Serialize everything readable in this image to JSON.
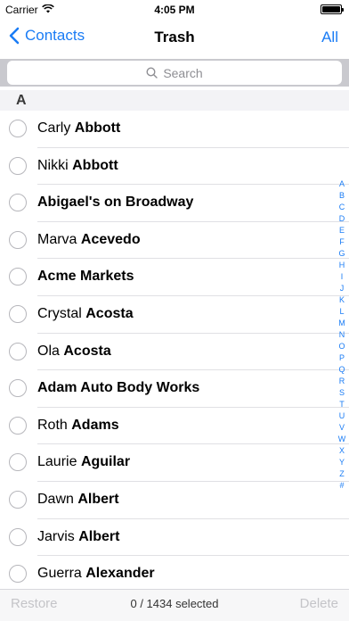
{
  "status_bar": {
    "carrier": "Carrier",
    "time": "4:05 PM"
  },
  "nav": {
    "back_label": "Contacts",
    "title": "Trash",
    "all_label": "All"
  },
  "search": {
    "placeholder": "Search"
  },
  "section": {
    "letter": "A"
  },
  "contacts": [
    {
      "first": "Carly",
      "last": "Abbott"
    },
    {
      "first": "Nikki",
      "last": "Abbott"
    },
    {
      "first": "",
      "last": "Abigael's on Broadway"
    },
    {
      "first": "Marva",
      "last": "Acevedo"
    },
    {
      "first": "",
      "last": "Acme Markets"
    },
    {
      "first": "Crystal",
      "last": "Acosta"
    },
    {
      "first": "Ola",
      "last": "Acosta"
    },
    {
      "first": "",
      "last": "Adam Auto Body Works"
    },
    {
      "first": "Roth",
      "last": "Adams"
    },
    {
      "first": "Laurie",
      "last": "Aguilar"
    },
    {
      "first": "Dawn",
      "last": "Albert"
    },
    {
      "first": "Jarvis",
      "last": "Albert"
    },
    {
      "first": "Guerra",
      "last": "Alexander"
    }
  ],
  "index_letters": [
    "A",
    "B",
    "C",
    "D",
    "E",
    "F",
    "G",
    "H",
    "I",
    "J",
    "K",
    "L",
    "M",
    "N",
    "O",
    "P",
    "Q",
    "R",
    "S",
    "T",
    "U",
    "V",
    "W",
    "X",
    "Y",
    "Z",
    "#"
  ],
  "toolbar": {
    "restore_label": "Restore",
    "selected_text": "0 / 1434 selected",
    "delete_label": "Delete"
  }
}
